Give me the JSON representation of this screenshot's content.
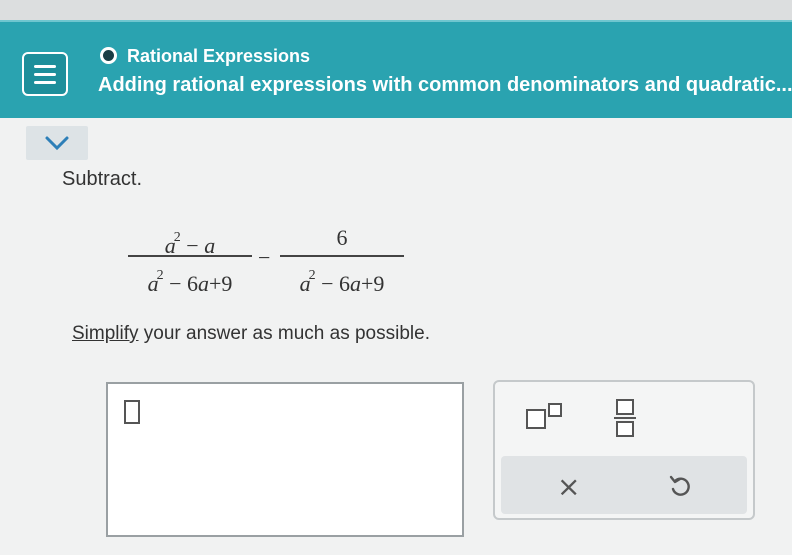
{
  "header": {
    "topic": "Rational Expressions",
    "title": "Adding rational expressions with common denominators and quadratic..."
  },
  "problem": {
    "prompt": "Subtract.",
    "frac1": {
      "num": "a² − a",
      "den": "a² − 6a + 9"
    },
    "operator": "−",
    "frac2": {
      "num": "6",
      "den": "a² − 6a + 9"
    },
    "instruction_link": "Simplify",
    "instruction_rest": " your answer as much as possible."
  },
  "toolpad": {
    "clear_label": "×"
  },
  "icons": [
    "menu-icon",
    "ring-icon",
    "chevron-down-icon",
    "exponent-icon",
    "fraction-icon",
    "undo-icon"
  ],
  "colors": {
    "header": "#2aa3b0",
    "background": "#f1f2f2"
  }
}
